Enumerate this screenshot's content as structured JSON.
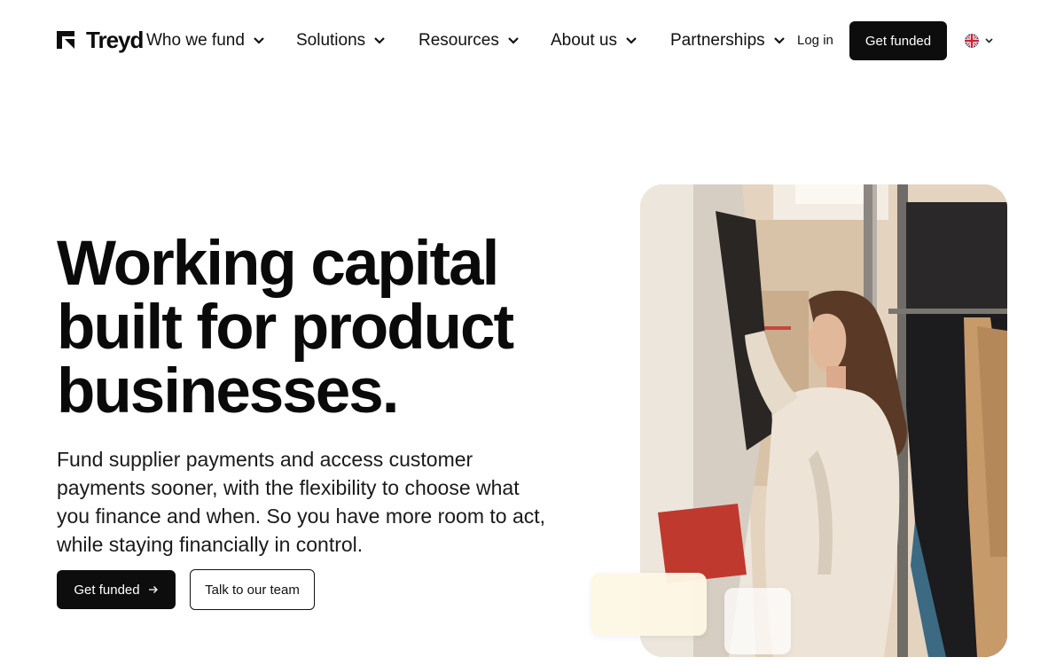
{
  "brand": {
    "name": "Treyd"
  },
  "nav": {
    "items": [
      {
        "label": "Who we fund"
      },
      {
        "label": "Solutions"
      },
      {
        "label": "Resources"
      },
      {
        "label": "About us"
      },
      {
        "label": "Partnerships"
      }
    ],
    "login_label": "Log in",
    "cta_label": "Get funded",
    "language_icon": "uk-flag-icon"
  },
  "hero": {
    "title_lines": [
      "Working capital",
      "built for product",
      "businesses."
    ],
    "subtitle_lines": [
      "Fund supplier payments and access customer",
      "payments sooner, with the flexibility to choose what",
      "you finance and when. So you have more room to act,",
      "while staying financially in control."
    ],
    "primary_cta": "Get funded",
    "secondary_cta": "Talk to our team",
    "image_icon": "woman-browsing-clothing-rack-photo"
  },
  "colors": {
    "text": "#0d0d0d",
    "button_bg": "#0d0d0d",
    "button_text": "#ffffff",
    "card_cream": "#fdf7e4"
  }
}
